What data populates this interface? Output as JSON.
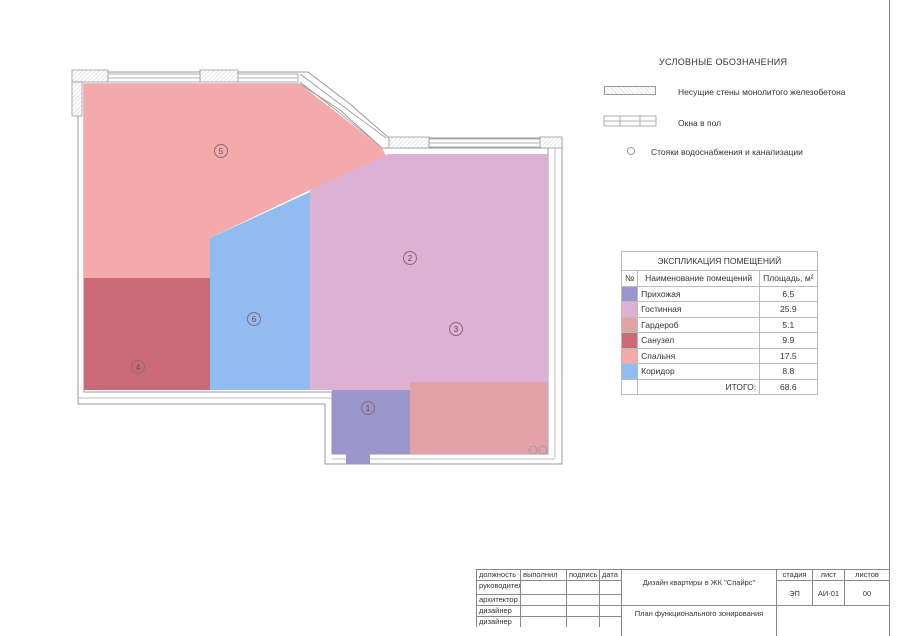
{
  "legend": {
    "title": "УСЛОВНЫЕ ОБОЗНАЧЕНИЯ",
    "walls": "Несущие стены монолитого железобетона",
    "windows": "Окна в пол",
    "risers": "Стояки водоснабжения и канализации"
  },
  "explication": {
    "title": "ЭКСПЛИКАЦИЯ ПОМЕЩЕНИЙ",
    "col_num": "№",
    "col_name": "Наименование помещений",
    "col_area": "Площадь, м²",
    "rows": [
      {
        "name": "Прихожая",
        "area": "6.5",
        "color": "#9a96cc"
      },
      {
        "name": "Гостинная",
        "area": "25.9",
        "color": "#dcb1d3"
      },
      {
        "name": "Гардероб",
        "area": "5.1",
        "color": "#e2a2a8"
      },
      {
        "name": "Санузел",
        "area": "9.9",
        "color": "#cc6977"
      },
      {
        "name": "Спальня",
        "area": "17.5",
        "color": "#f4a9aa"
      },
      {
        "name": "Коридор",
        "area": "8.8",
        "color": "#92bbf2"
      }
    ],
    "total_label": "ИТОГО:",
    "total": "68.6"
  },
  "rooms": {
    "r1": "1",
    "r2": "2",
    "r3": "3",
    "r4": "4",
    "r5": "5",
    "r6": "6"
  },
  "stamp": {
    "h_role": "должность",
    "h_done": "выполнил",
    "h_sign": "подпись",
    "h_date": "дата",
    "role1": "руководитель",
    "role2": "архитектор",
    "role3": "дизайнер",
    "role4": "дизайнер",
    "project": "Дизайн квартиры в ЖК \"Спайрс\"",
    "sheet_title": "План функционального зонирования",
    "h_stage": "стадия",
    "h_sheet": "лист",
    "h_sheets": "листов",
    "stage": "ЭП",
    "sheet": "АИ-01",
    "sheets": "00"
  }
}
